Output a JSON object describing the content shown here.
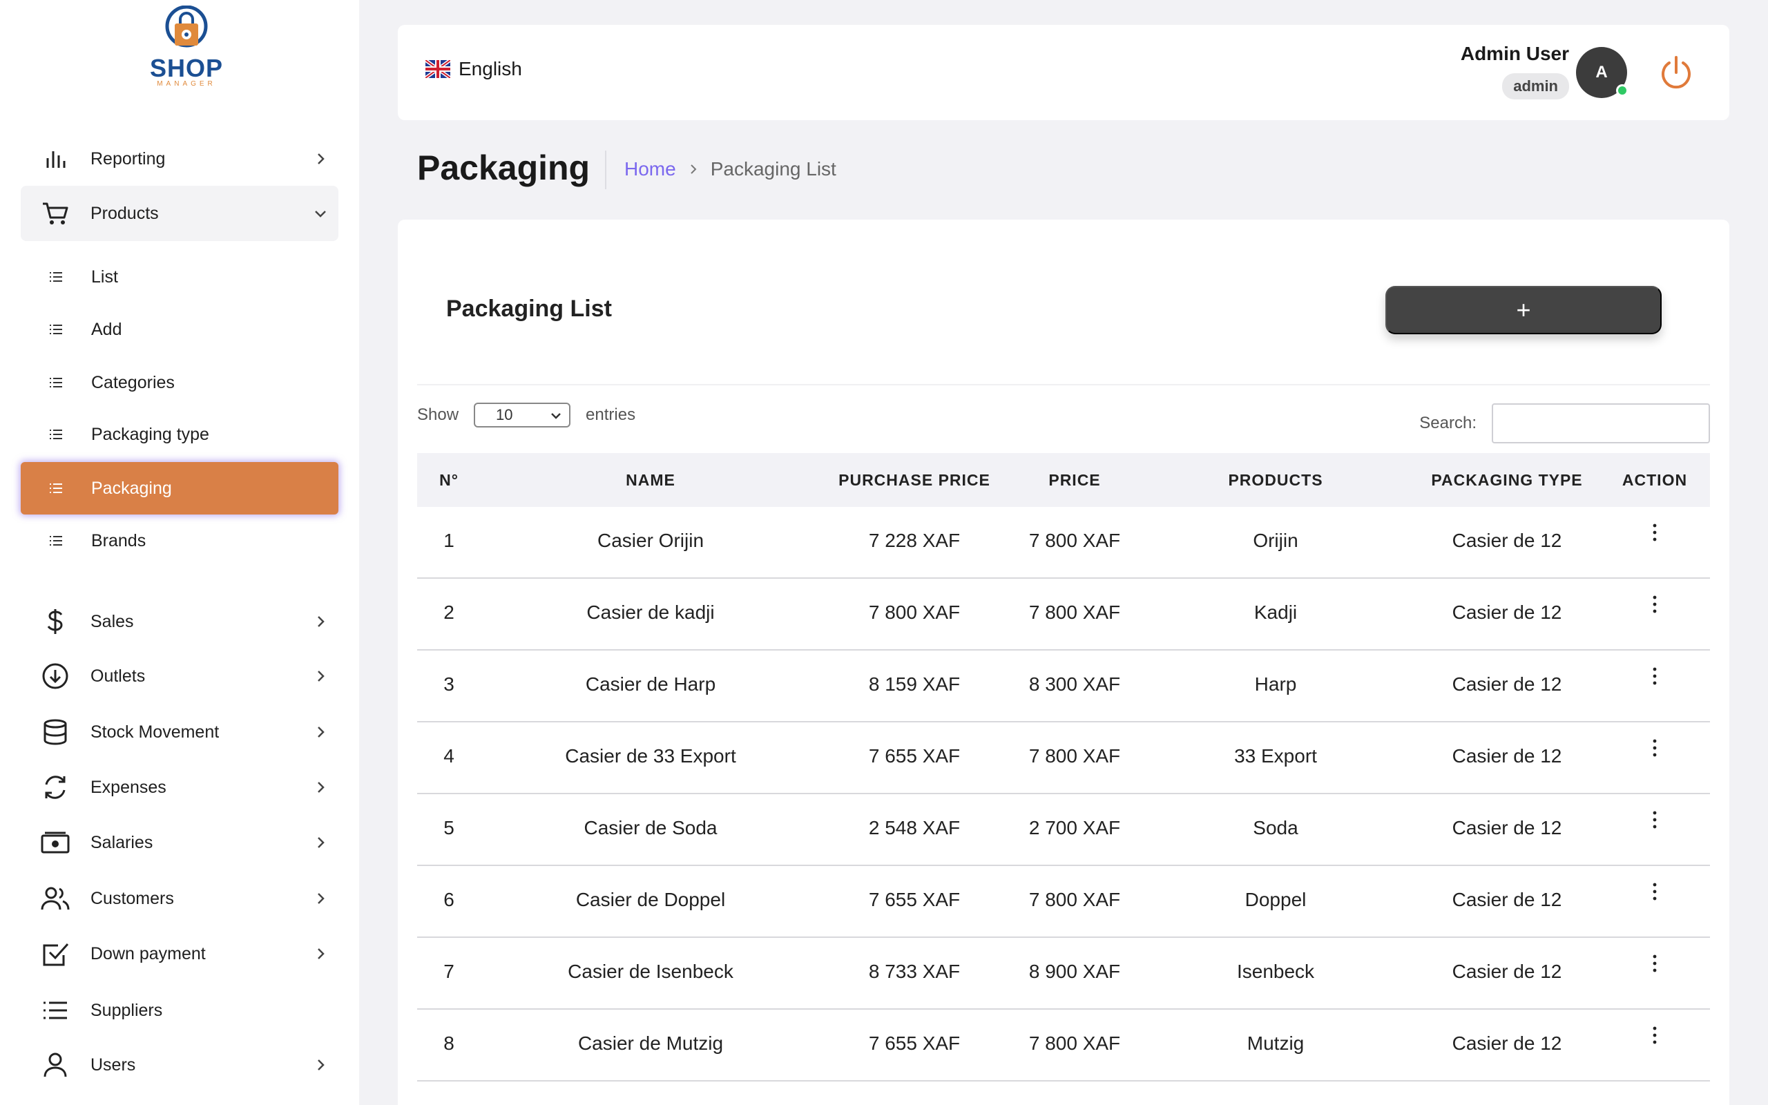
{
  "logo": {
    "text": "SHOP",
    "sub": "MANAGER"
  },
  "sidebar": {
    "items": [
      {
        "key": "reporting",
        "label": "Reporting",
        "icon": "bar-chart-icon"
      },
      {
        "key": "products",
        "label": "Products",
        "icon": "cart-icon"
      },
      {
        "key": "sales",
        "label": "Sales",
        "icon": "dollar-icon"
      },
      {
        "key": "outlets",
        "label": "Outlets",
        "icon": "circle-down-icon"
      },
      {
        "key": "stock",
        "label": "Stock Movement",
        "icon": "database-icon"
      },
      {
        "key": "expenses",
        "label": "Expenses",
        "icon": "refresh-icon"
      },
      {
        "key": "salaries",
        "label": "Salaries",
        "icon": "cash-icon"
      },
      {
        "key": "customers",
        "label": "Customers",
        "icon": "users-icon"
      },
      {
        "key": "downpayment",
        "label": "Down payment",
        "icon": "check-square-icon"
      },
      {
        "key": "suppliers",
        "label": "Suppliers",
        "icon": "list-icon"
      },
      {
        "key": "users",
        "label": "Users",
        "icon": "user-icon"
      }
    ],
    "products_sub": [
      {
        "label": "List"
      },
      {
        "label": "Add"
      },
      {
        "label": "Categories"
      },
      {
        "label": "Packaging type"
      },
      {
        "label": "Packaging"
      },
      {
        "label": "Brands"
      }
    ]
  },
  "header": {
    "language": "English",
    "user_name": "Admin User",
    "user_role": "admin",
    "avatar_initial": "A"
  },
  "page": {
    "title": "Packaging",
    "breadcrumb_home": "Home",
    "breadcrumb_current": "Packaging List"
  },
  "card": {
    "title": "Packaging List",
    "add_label": "+",
    "show_label": "Show",
    "entries_value": "10",
    "entries_label": "entries",
    "search_label": "Search:",
    "search_value": ""
  },
  "table": {
    "columns": [
      "N°",
      "NAME",
      "PURCHASE PRICE",
      "PRICE",
      "PRODUCTS",
      "PACKAGING TYPE",
      "ACTION"
    ],
    "rows": [
      [
        "1",
        "Casier Orijin",
        "7 228 XAF",
        "7 800 XAF",
        "Orijin",
        "Casier de 12"
      ],
      [
        "2",
        "Casier de kadji",
        "7 800 XAF",
        "7 800 XAF",
        "Kadji",
        "Casier de 12"
      ],
      [
        "3",
        "Casier de Harp",
        "8 159 XAF",
        "8 300 XAF",
        "Harp",
        "Casier de 12"
      ],
      [
        "4",
        "Casier de 33 Export",
        "7 655 XAF",
        "7 800 XAF",
        "33 Export",
        "Casier de 12"
      ],
      [
        "5",
        "Casier de Soda",
        "2 548 XAF",
        "2 700 XAF",
        "Soda",
        "Casier de 12"
      ],
      [
        "6",
        "Casier de Doppel",
        "7 655 XAF",
        "7 800 XAF",
        "Doppel",
        "Casier de 12"
      ],
      [
        "7",
        "Casier de Isenbeck",
        "8 733 XAF",
        "8 900 XAF",
        "Isenbeck",
        "Casier de 12"
      ],
      [
        "8",
        "Casier de Mutzig",
        "7 655 XAF",
        "7 800 XAF",
        "Mutzig",
        "Casier de 12"
      ]
    ]
  },
  "colors": {
    "accent": "#d98047",
    "link": "#7b68ee",
    "brand": "#1b4f93",
    "online": "#2fc964",
    "power": "#e07a3a"
  }
}
